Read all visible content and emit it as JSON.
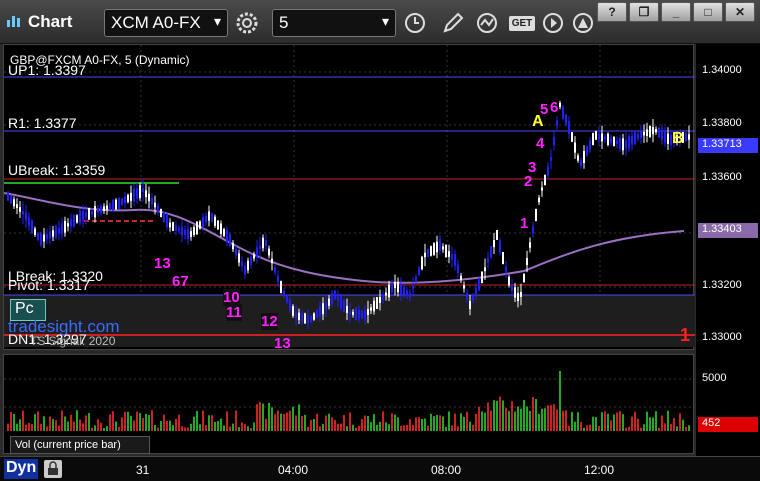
{
  "window": {
    "title": "Chart",
    "symbol": "XCM A0-FX",
    "interval": "5"
  },
  "toolbar": {
    "icons": [
      "settings-icon",
      "clock-icon",
      "pencil-icon",
      "study-icon",
      "get-icon",
      "play-icon",
      "help-icon"
    ],
    "get_label": "GET"
  },
  "window_buttons": {
    "help": "?",
    "restore": "❐",
    "minimize": "_",
    "maximize": "□",
    "close": "✕"
  },
  "chart": {
    "instrument_label": "GBP@FXCM A0-FX, 5 (Dynamic)",
    "levels": {
      "up1": "UP1: 1.3397",
      "r1": "R1: 1.3377",
      "ubreak": "UBreak: 1.3359",
      "lbreak": "LBreak: 1.3320",
      "pivot": "Pivot: 1.3317",
      "dn1": "DN1: 1.3297"
    },
    "pc_label": "Pc",
    "watermark": "tradesight.com",
    "signal_label": "TS Signal: 2020",
    "price_axis": [
      "1.34000",
      "1.33800",
      "1.33600",
      "1.33400",
      "1.33200",
      "1.33000"
    ],
    "current_price": "1.33713",
    "ma_price": "1.33403",
    "marker_labels": [
      "A",
      "B",
      "1"
    ],
    "magenta_counts": [
      "5",
      "6",
      "4",
      "3",
      "2",
      "1",
      "13",
      "67",
      "10",
      "11",
      "12",
      "13"
    ],
    "colors": {
      "up_candle": "#ffffff",
      "down_candle": "#2020ff",
      "ma_line": "#9a6fc4",
      "level_line": "#4a4aff",
      "break_line": "#cc2222",
      "count_magenta": "#ff22ff",
      "count_green": "#22aa22",
      "marker_yellow": "#ffff33"
    }
  },
  "volume": {
    "caption": "Vol (current price bar)",
    "axis_label": "5000",
    "current": "452"
  },
  "time_axis": [
    "31",
    "04:00",
    "08:00",
    "12:00"
  ],
  "status": {
    "dyn_label": "Dyn"
  }
}
